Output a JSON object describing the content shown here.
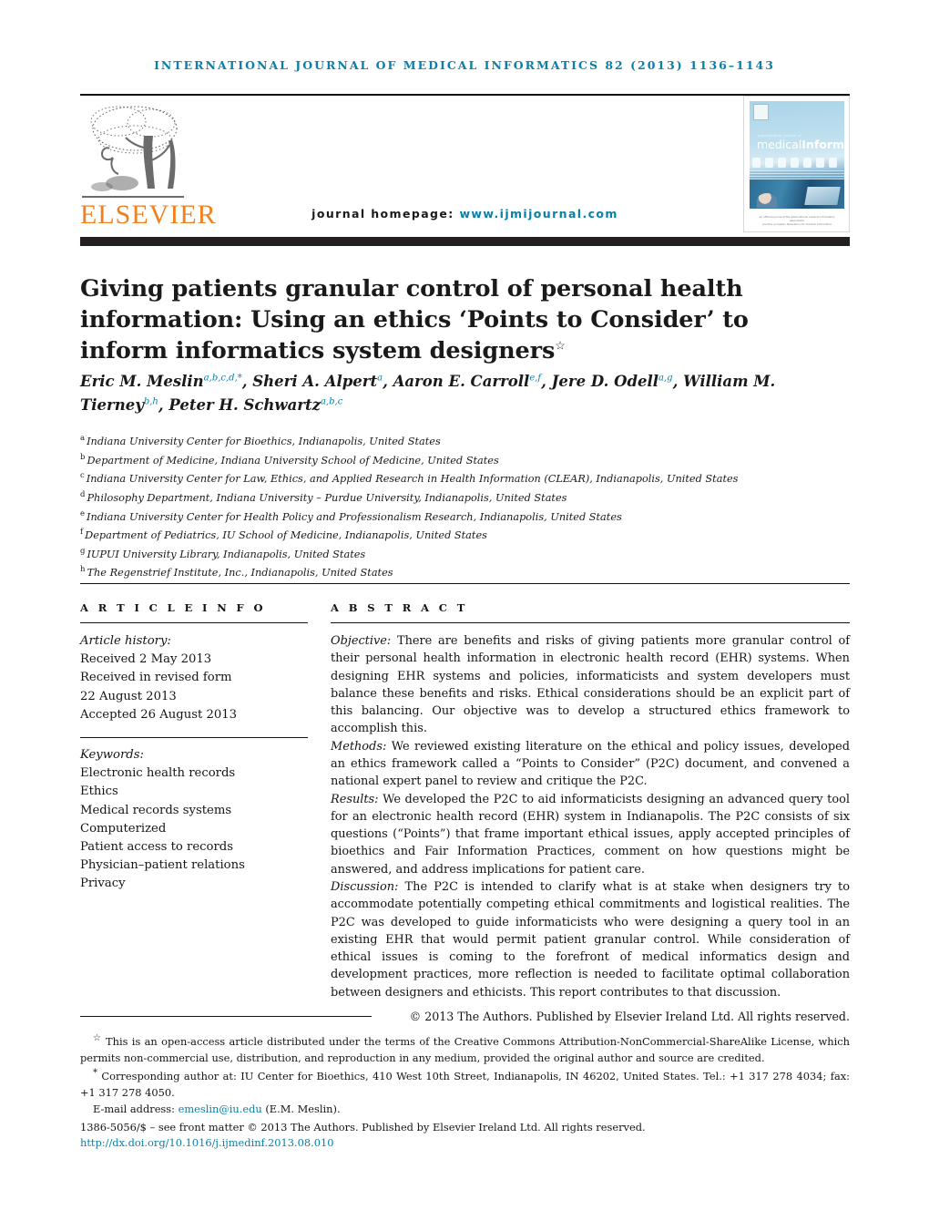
{
  "running_head": "International Journal of Medical Informatics 82 (2013) 1136–1143",
  "masthead": {
    "publisher_wordmark": "ELSEVIER",
    "homepage_label": "journal homepage:",
    "homepage_url": "www.ijmijournal.com",
    "cover": {
      "kicker": "international journal of",
      "title_light": "medical",
      "title_bold": "Informatics",
      "footer_line1": "an official journal of the international medical informatics association",
      "footer_line2": "and the european federation for medical informatics"
    }
  },
  "title": {
    "text": "Giving patients granular control of personal health information: Using an ethics ‘Points to Consider’ to inform informatics system designers",
    "marker": "☆"
  },
  "authors": [
    {
      "name": "Eric M. Meslin",
      "sup": "a,b,c,d,*"
    },
    {
      "name": "Sheri A. Alpert",
      "sup": "a"
    },
    {
      "name": "Aaron E. Carroll",
      "sup": "e,f"
    },
    {
      "name": "Jere D. Odell",
      "sup": "a,g"
    },
    {
      "name": "William M. Tierney",
      "sup": "b,h"
    },
    {
      "name": "Peter H. Schwartz",
      "sup": "a,b,c"
    }
  ],
  "affiliations": [
    {
      "mark": "a",
      "text": "Indiana University Center for Bioethics, Indianapolis, United States"
    },
    {
      "mark": "b",
      "text": "Department of Medicine, Indiana University School of Medicine, United States"
    },
    {
      "mark": "c",
      "text": "Indiana University Center for Law, Ethics, and Applied Research in Health Information (CLEAR), Indianapolis, United States"
    },
    {
      "mark": "d",
      "text": "Philosophy Department, Indiana University – Purdue University, Indianapolis, United States"
    },
    {
      "mark": "e",
      "text": "Indiana University Center for Health Policy and Professionalism Research, Indianapolis, United States"
    },
    {
      "mark": "f",
      "text": "Department of Pediatrics, IU School of Medicine, Indianapolis, United States"
    },
    {
      "mark": "g",
      "text": "IUPUI University Library, Indianapolis, United States"
    },
    {
      "mark": "h",
      "text": "The Regenstrief Institute, Inc., Indianapolis, United States"
    }
  ],
  "article_info": {
    "heading": "A R T I C L E   I N F O",
    "history_label": "Article history:",
    "history": [
      "Received 2 May 2013",
      "Received in revised form",
      "22 August 2013",
      "Accepted 26 August 2013"
    ],
    "keywords_label": "Keywords:",
    "keywords": [
      "Electronic health records",
      "Ethics",
      "Medical records systems",
      "Computerized",
      "Patient access to records",
      "Physician–patient relations",
      "Privacy"
    ]
  },
  "abstract": {
    "heading": "A B S T R A C T",
    "sections": [
      {
        "label": "Objective:",
        "text": " There are benefits and risks of giving patients more granular control of their personal health information in electronic health record (EHR) systems. When designing EHR systems and policies, informaticists and system developers must balance these benefits and risks. Ethical considerations should be an explicit part of this balancing. Our objective was to develop a structured ethics framework to accomplish this."
      },
      {
        "label": "Methods:",
        "text": " We reviewed existing literature on the ethical and policy issues, developed an ethics framework called a “Points to Consider” (P2C) document, and convened a national expert panel to review and critique the P2C."
      },
      {
        "label": "Results:",
        "text": " We developed the P2C to aid informaticists designing an advanced query tool for an electronic health record (EHR) system in Indianapolis. The P2C consists of six questions (“Points”) that frame important ethical issues, apply accepted principles of bioethics and Fair Information Practices, comment on how questions might be answered, and address implications for patient care."
      },
      {
        "label": "Discussion:",
        "text": " The P2C is intended to clarify what is at stake when designers try to accommodate potentially competing ethical commitments and logistical realities. The P2C was developed to guide informaticists who were designing a query tool in an existing EHR that would permit patient granular control. While consideration of ethical issues is coming to the forefront of medical informatics design and development practices, more reflection is needed to facilitate optimal collaboration between designers and ethicists. This report contributes to that discussion."
      }
    ],
    "copyright": "© 2013 The Authors. Published by Elsevier Ireland Ltd. All rights reserved."
  },
  "footnotes": {
    "open_access_mark": "☆",
    "open_access": "This is an open-access article distributed under the terms of the Creative Commons Attribution-NonCommercial-ShareAlike License, which permits non-commercial use, distribution, and reproduction in any medium, provided the original author and source are credited.",
    "corresponding_mark": "*",
    "corresponding": "Corresponding author at: IU Center for Bioethics, 410 West 10th Street, Indianapolis, IN 46202, United States. Tel.: +1 317 278 4034; fax: +1 317 278 4050.",
    "email_label": "E-mail address:",
    "email": "emeslin@iu.edu",
    "email_suffix": "(E.M. Meslin).",
    "front_matter": "1386-5056/$ – see front matter © 2013 The Authors. Published by Elsevier Ireland Ltd. All rights reserved.",
    "doi": "http://dx.doi.org/10.1016/j.ijmedinf.2013.08.010"
  }
}
